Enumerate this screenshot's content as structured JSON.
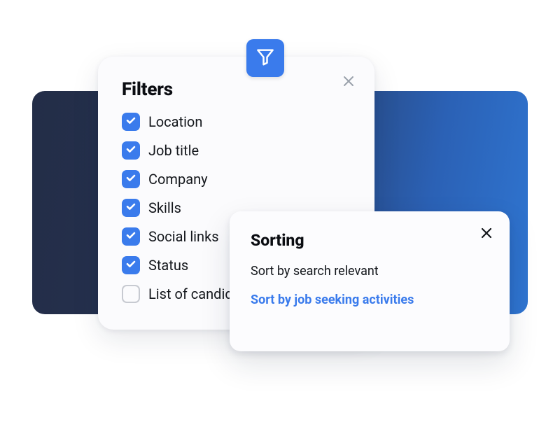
{
  "colors": {
    "accent": "#3a7bec"
  },
  "filters": {
    "title": "Filters",
    "items": [
      {
        "label": "Location",
        "checked": true
      },
      {
        "label": "Job title",
        "checked": true
      },
      {
        "label": "Company",
        "checked": true
      },
      {
        "label": "Skills",
        "checked": true
      },
      {
        "label": "Social links",
        "checked": true
      },
      {
        "label": "Status",
        "checked": true
      },
      {
        "label": "List of candidates",
        "checked": false
      }
    ]
  },
  "sorting": {
    "title": "Sorting",
    "options": [
      {
        "label": "Sort by search relevant",
        "active": false
      },
      {
        "label": "Sort by job seeking activities",
        "active": true
      }
    ]
  }
}
